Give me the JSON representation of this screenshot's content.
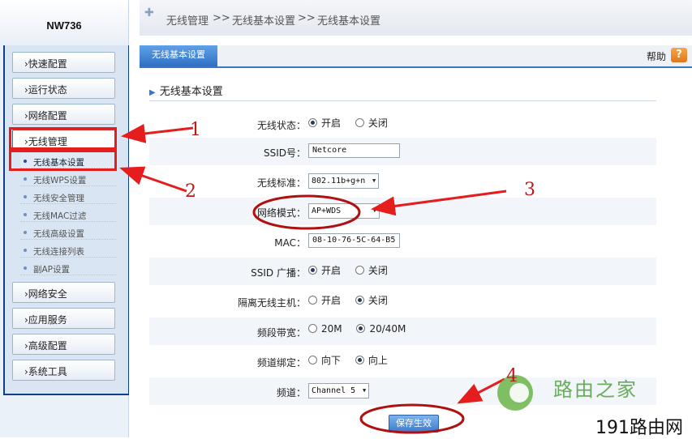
{
  "brand": "NW736",
  "breadcrumb": [
    "无线管理",
    ">>",
    "无线基本设置",
    ">>",
    "无线基本设置"
  ],
  "tab": "无线基本设置",
  "help": "帮助",
  "help_icon_glyph": "?",
  "sidebar": {
    "menus_top": [
      "›快速配置",
      "›运行状态",
      "›网络配置"
    ],
    "active_menu": "›无线管理",
    "sub_items": [
      "无线基本设置",
      "无线WPS设置",
      "无线安全管理",
      "无线MAC过滤",
      "无线高级设置",
      "无线连接列表",
      "副AP设置"
    ],
    "menus_bottom": [
      "›网络安全",
      "›应用服务",
      "›高级配置",
      "›系统工具"
    ]
  },
  "section_title": "无线基本设置",
  "form": {
    "wireless_status": {
      "label": "无线状态：",
      "options": [
        "开启",
        "关闭"
      ],
      "selected": "开启"
    },
    "ssid": {
      "label": "SSID号：",
      "value": "Netcore"
    },
    "standard": {
      "label": "无线标准：",
      "value": "802.11b+g+n"
    },
    "net_mode": {
      "label": "网络模式：",
      "value": "AP+WDS"
    },
    "mac": {
      "label": "MAC：",
      "value": "08-10-76-5C-64-B5"
    },
    "ssid_broadcast": {
      "label": "SSID 广播：",
      "options": [
        "开启",
        "关闭"
      ],
      "selected": "开启"
    },
    "isolation": {
      "label": "隔离无线主机：",
      "options": [
        "开启",
        "关闭"
      ],
      "selected": "关闭"
    },
    "bandwidth": {
      "label": "频段带宽：",
      "options": [
        "20M",
        "20/40M"
      ],
      "selected": "20/40M"
    },
    "channel_bind": {
      "label": "频道绑定：",
      "options": [
        "向下",
        "向上"
      ],
      "selected": "向上"
    },
    "channel": {
      "label": "频道：",
      "value": "Channel 5"
    }
  },
  "save_button": "保存生效",
  "annotations": [
    "1",
    "2",
    "3",
    "4"
  ],
  "watermark": {
    "brand": "路由之家",
    "site": "191路由网"
  },
  "colors": {
    "accent": "#3a77c5",
    "annotation_red": "#e51d1d",
    "watermark_green": "#5aa64a"
  }
}
